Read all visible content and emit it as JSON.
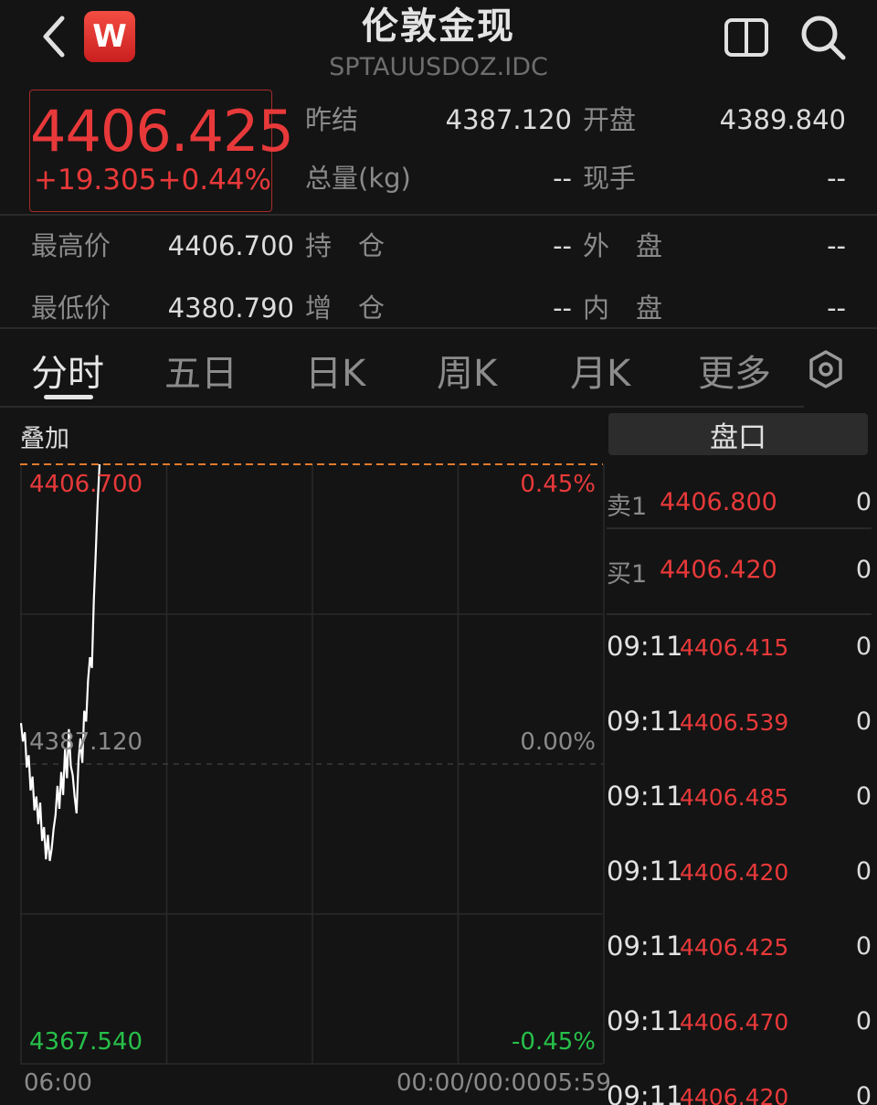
{
  "header": {
    "title": "伦敦金现",
    "subtitle": "SPTAUUSDOZ.IDC",
    "badge": "W"
  },
  "quote": {
    "last_price": "4406.425",
    "change": "+19.305",
    "change_pct": "+0.44%",
    "prev_settle_label": "昨结",
    "prev_settle": "4387.120",
    "open_label": "开盘",
    "open": "4389.840",
    "volume_label": "总量(kg)",
    "volume": "--",
    "current_hand_label": "现手",
    "current_hand": "--",
    "high_label": "最高价",
    "high": "4406.700",
    "open_interest_label": "持　仓",
    "open_interest": "--",
    "outer_label": "外　盘",
    "outer": "--",
    "low_label": "最低价",
    "low": "4380.790",
    "oi_change_label": "增　仓",
    "oi_change": "--",
    "inner_label": "内　盘",
    "inner": "--"
  },
  "tabs": [
    "分时",
    "五日",
    "日K",
    "周K",
    "月K",
    "更多"
  ],
  "chart_area": {
    "overlay_label": "叠加",
    "time_start": "06:00",
    "time_mid": "00:00/00:00",
    "time_end": "05:59"
  },
  "chart_data": {
    "type": "line",
    "y_labels_left": {
      "top": "4406.700",
      "mid": "4387.120",
      "bottom": "4367.540"
    },
    "y_labels_right": {
      "top": "0.45%",
      "mid": "0.00%",
      "bottom": "-0.45%"
    },
    "ylim": [
      4367.54,
      4406.7
    ],
    "reference": 4387.12,
    "colors": {
      "up": "#e8393a",
      "down": "#27c04a",
      "line": "#ffffff",
      "ref": "#e07a2e"
    },
    "series": [
      {
        "values": [
          4389.8,
          4388.6,
          4389.2,
          4386.9,
          4387.7,
          4385.4,
          4386.3,
          4384.1,
          4385.0,
          4383.2,
          4384.6,
          4382.1,
          4383.0,
          4380.9,
          4382.5,
          4380.8,
          4381.6,
          4382.9,
          4383.8,
          4385.7,
          4384.2,
          4386.6,
          4385.1,
          4388.1,
          4386.2,
          4389.4,
          4387.0,
          4386.4,
          4385.0,
          4383.9,
          4387.3,
          4388.8,
          4387.2,
          4390.6,
          4389.9,
          4392.6,
          4394.1,
          4393.4,
          4397.8,
          4400.9,
          4404.2,
          4406.7
        ]
      }
    ]
  },
  "order_book": {
    "tab_label": "盘口",
    "sell1_label": "卖1",
    "sell1_price": "4406.800",
    "sell1_vol": "0",
    "buy1_label": "买1",
    "buy1_price": "4406.420",
    "buy1_vol": "0"
  },
  "ticks": [
    {
      "time": "09:11",
      "price": "4406.415",
      "vol": "0"
    },
    {
      "time": "09:11",
      "price": "4406.539",
      "vol": "0"
    },
    {
      "time": "09:11",
      "price": "4406.485",
      "vol": "0"
    },
    {
      "time": "09:11",
      "price": "4406.420",
      "vol": "0"
    },
    {
      "time": "09:11",
      "price": "4406.425",
      "vol": "0"
    },
    {
      "time": "09:11",
      "price": "4406.470",
      "vol": "0"
    },
    {
      "time": "09:11",
      "price": "4406.420",
      "vol": "0"
    }
  ]
}
